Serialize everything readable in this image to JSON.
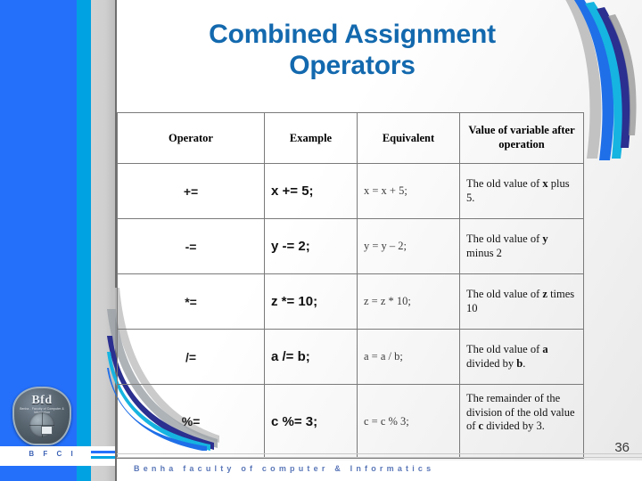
{
  "slide": {
    "title_line1": "Combined Assignment",
    "title_line2": "Operators",
    "page_number": "36",
    "title_color": "#1369ae"
  },
  "sidebar": {
    "logo_mark": "Bfd",
    "logo_subtitle": "Benha - Faculty of Computer & Information",
    "brand_abbr": "B F C I",
    "rail_blue": "#2470fb",
    "rail_cyan": "#00a2e2"
  },
  "table": {
    "headers": [
      "Operator",
      "Example",
      "Equivalent",
      "Value of variable after operation"
    ],
    "rows": [
      {
        "operator": "+=",
        "example": "x += 5;",
        "equivalent": "x = x + 5;",
        "value_prefix": "The old value of ",
        "value_var": "x",
        "value_suffix": " plus 5."
      },
      {
        "operator": "-=",
        "example": "y -= 2;",
        "equivalent": "y = y – 2;",
        "value_prefix": "The old value of ",
        "value_var": "y",
        "value_suffix": " minus 2"
      },
      {
        "operator": "*=",
        "example": "z *= 10;",
        "equivalent": "z = z * 10;",
        "value_prefix": "The old value of ",
        "value_var": "z",
        "value_suffix": " times 10"
      },
      {
        "operator": "/=",
        "example": "a /= b;",
        "equivalent": "a = a / b;",
        "value_prefix": "The old value of ",
        "value_var": "a",
        "value_mid": " divided by ",
        "value_var2": "b",
        "value_suffix": "."
      },
      {
        "operator": "%=",
        "example": "c %= 3;",
        "equivalent": "c = c % 3;",
        "value_prefix": "The remainder of the division of the old value of ",
        "value_var": "c",
        "value_suffix": " divided by 3."
      }
    ]
  },
  "footer": {
    "text": "Benha  faculty  of  computer  &  Informatics"
  }
}
